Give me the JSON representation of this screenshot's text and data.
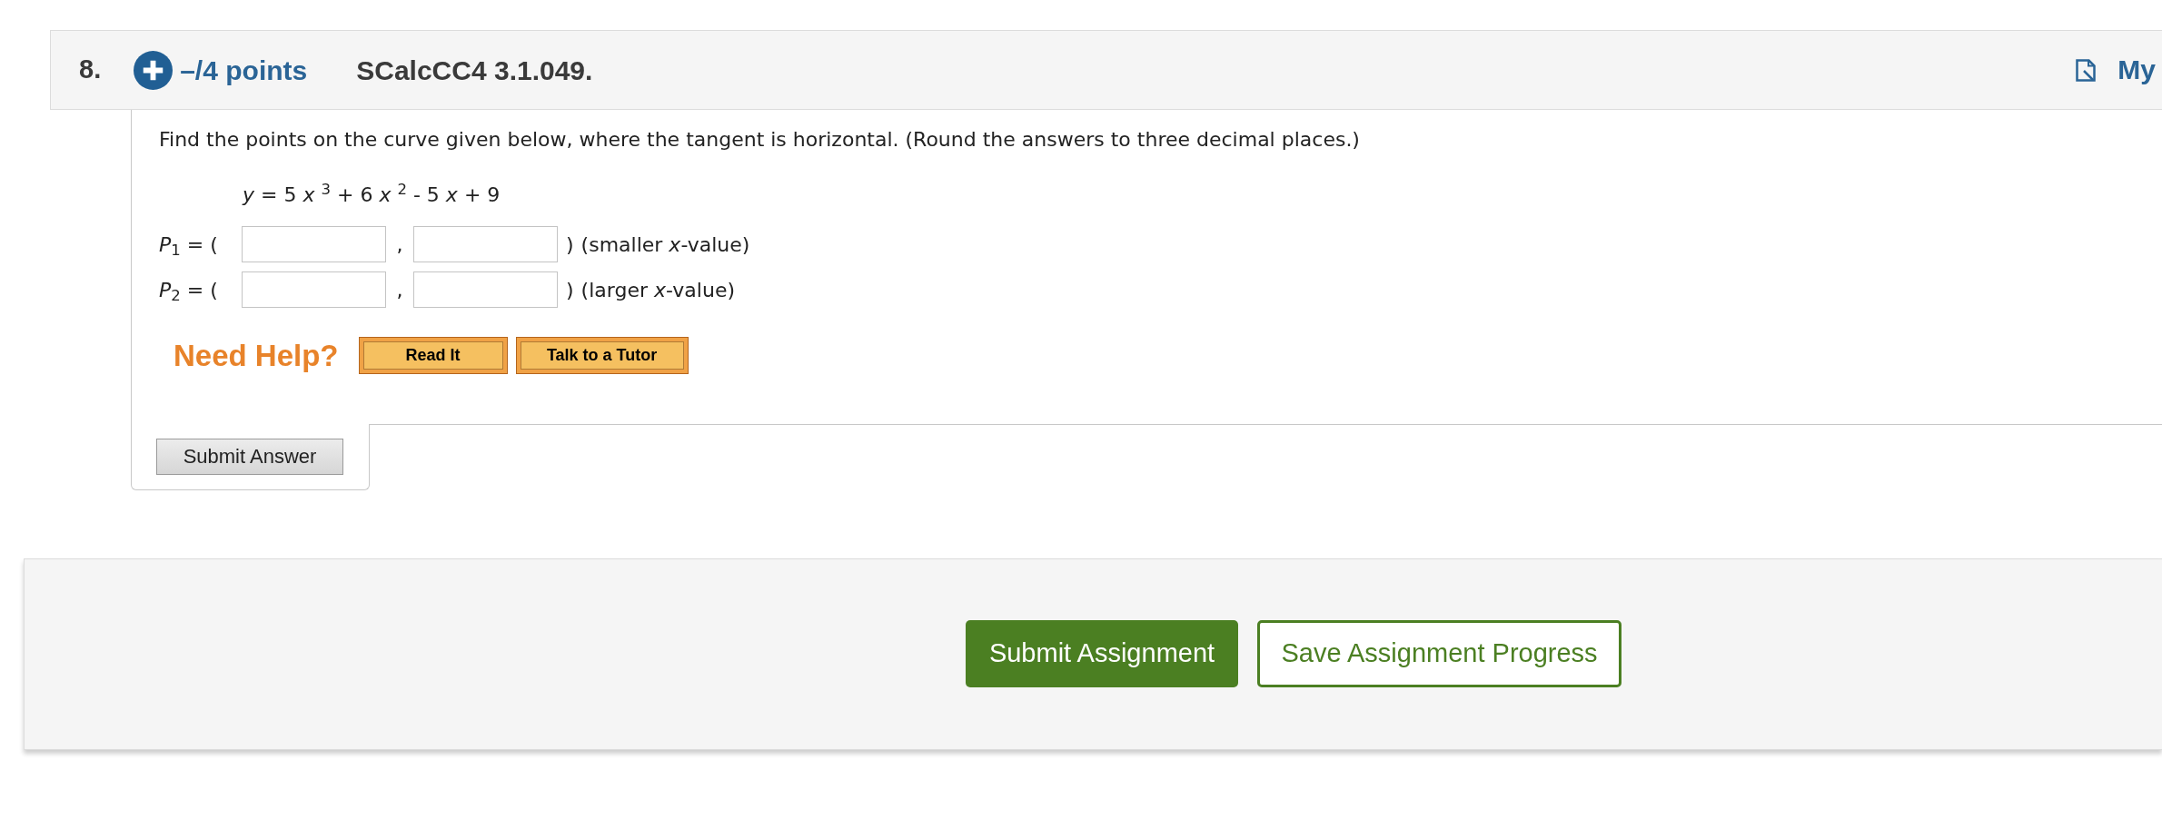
{
  "question": {
    "number": "8.",
    "points": "–/4 points",
    "code": "SCalcCC4 3.1.049.",
    "link": "My"
  },
  "prompt": "Find the points on the curve given below, where the tangent is horizontal. (Round the answers to three decimal places.)",
  "equation": "*y* = 5 *x* $^{3}$ + 6 *x* $^{2}$ - 5 *x* + 9",
  "answers": [
    {
      "label": "*P*$_{1}$ = (",
      "separator": ",",
      "close": ")",
      "note": "(smaller *x*-value)"
    },
    {
      "label": "*P*$_{2}$ = (",
      "separator": ",",
      "close": ")",
      "note": "(larger *x*-value)"
    }
  ],
  "help": {
    "label": "Need Help?",
    "buttons": [
      "Read It",
      "Talk to a Tutor"
    ]
  },
  "submit_answer": "Submit Answer",
  "footer_buttons": [
    {
      "label": "Submit Assignment",
      "kind": "primary"
    },
    {
      "label": "Save Assignment Progress",
      "kind": "secondary"
    }
  ]
}
